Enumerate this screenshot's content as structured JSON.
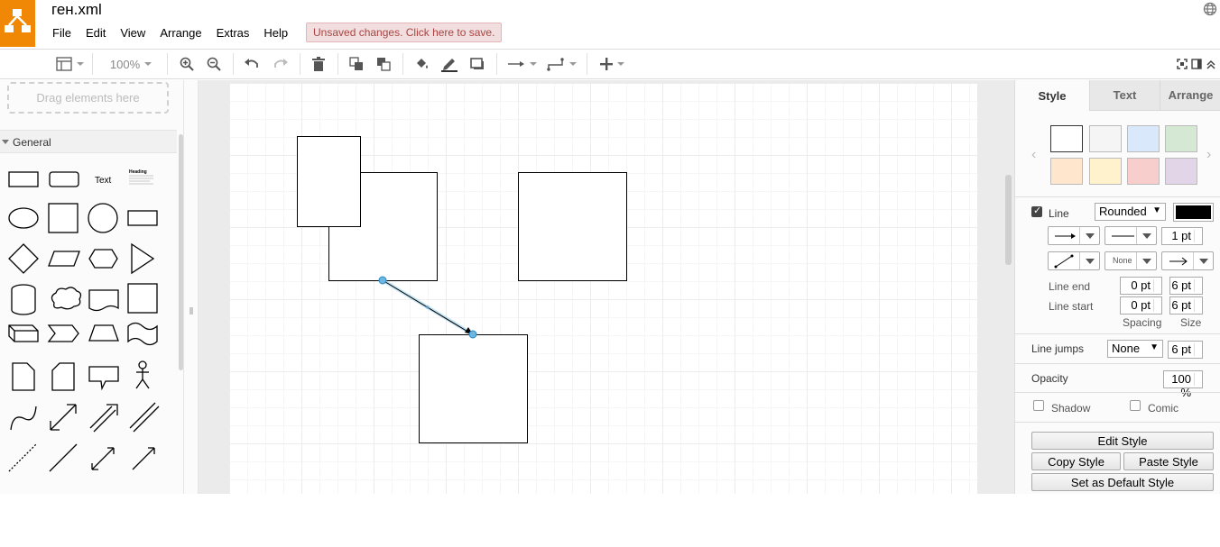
{
  "app": {
    "file_title": "ген.xml",
    "unsaved_notice": "Unsaved changes. Click here to save."
  },
  "menu": [
    "File",
    "Edit",
    "View",
    "Arrange",
    "Extras",
    "Help"
  ],
  "toolbar": {
    "zoom": "100%"
  },
  "sidebar": {
    "drag_hint": "Drag elements here",
    "section": "General",
    "text_shape_label": "Text",
    "heading_shape_label": "Heading"
  },
  "format_panel": {
    "tabs": [
      "Style",
      "Text",
      "Arrange"
    ],
    "active_tab": "Style",
    "swatches": [
      "#ffffff",
      "#f5f5f5",
      "#dae8fc",
      "#d5e8d4",
      "#ffe6cc",
      "#fff2cc",
      "#f8cecc",
      "#e1d5e7"
    ],
    "line": {
      "label": "Line",
      "checked": true,
      "style": "Rounded",
      "color": "#000000",
      "width": "1 pt",
      "waypoint_style": "None"
    },
    "line_end": {
      "label": "Line end",
      "spacing": "0 pt",
      "size": "6 pt"
    },
    "line_start": {
      "label": "Line start",
      "spacing": "0 pt",
      "size": "6 pt"
    },
    "spacing_label": "Spacing",
    "size_label": "Size",
    "line_jumps": {
      "label": "Line jumps",
      "value": "None",
      "size": "6 pt"
    },
    "opacity": {
      "label": "Opacity",
      "value": "100 %"
    },
    "shadow_label": "Shadow",
    "comic_label": "Comic",
    "buttons": {
      "edit_style": "Edit Style",
      "copy_style": "Copy Style",
      "paste_style": "Paste Style",
      "set_default": "Set as Default Style"
    }
  }
}
